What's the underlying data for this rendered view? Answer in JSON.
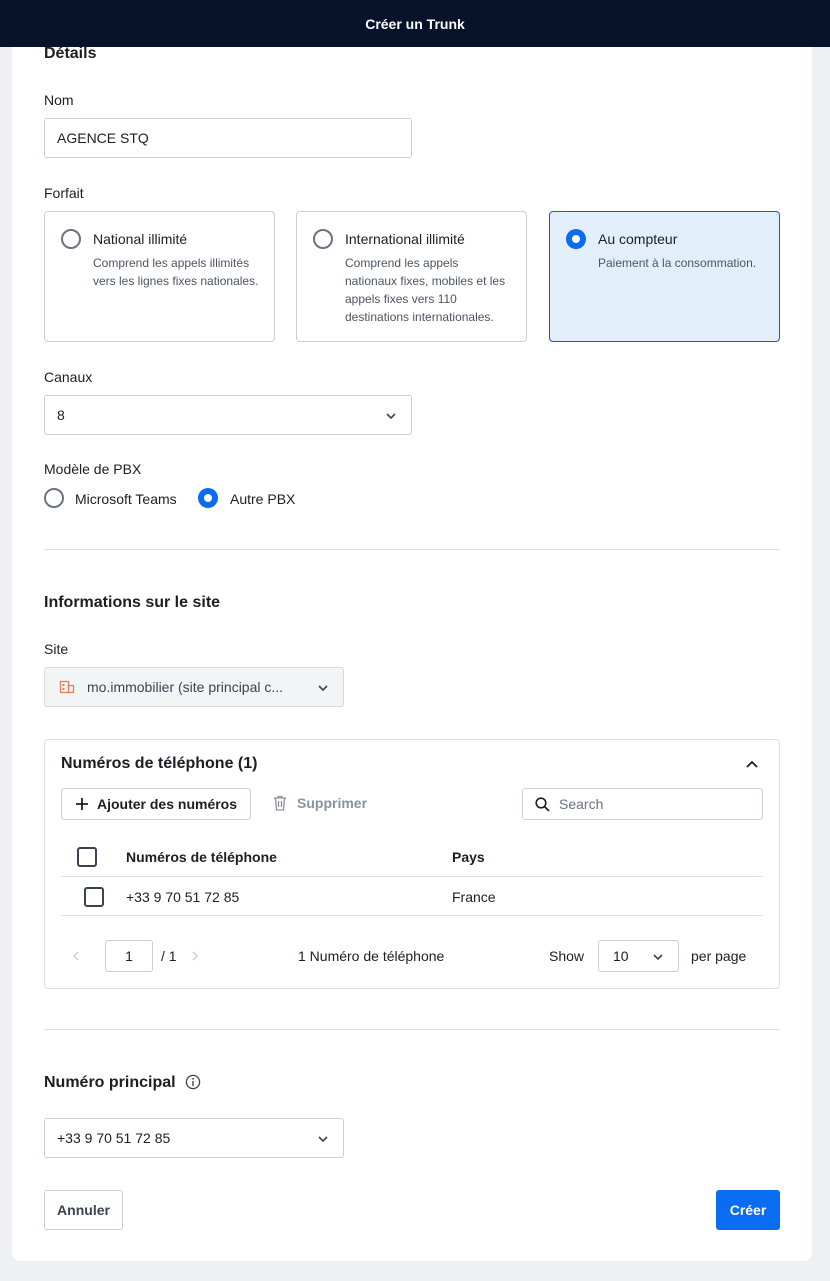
{
  "header": {
    "title": "Créer un Trunk"
  },
  "details": {
    "section_title": "Détails",
    "name_label": "Nom",
    "name_value": "AGENCE STQ",
    "plan_label": "Forfait",
    "plans": [
      {
        "title": "National illimité",
        "desc": "Comprend les appels illimités vers les lignes fixes nationales.",
        "selected": false
      },
      {
        "title": "International illimité",
        "desc": "Comprend les appels nationaux fixes, mobiles et les appels fixes vers 110 destinations internationales.",
        "selected": false
      },
      {
        "title": "Au compteur",
        "desc": "Paiement à la consommation.",
        "selected": true
      }
    ],
    "channels_label": "Canaux",
    "channels_value": "8",
    "pbx_label": "Modèle de PBX",
    "pbx_options": [
      {
        "label": "Microsoft Teams",
        "selected": false
      },
      {
        "label": "Autre PBX",
        "selected": true
      }
    ]
  },
  "site": {
    "section_title": "Informations sur le site",
    "site_label": "Site",
    "site_value": "mo.immobilier (site principal c...",
    "site_icon": "building-icon"
  },
  "phones": {
    "title": "Numéros de téléphone (1)",
    "add_label": "Ajouter des numéros",
    "delete_label": "Supprimer",
    "search_placeholder": "Search",
    "columns": [
      "Numéros de téléphone",
      "Pays"
    ],
    "rows": [
      {
        "number": "+33 9 70 51 72 85",
        "country": "France"
      }
    ],
    "pagination": {
      "page": "1",
      "total_pages": "/ 1",
      "count_text": "1 Numéro de téléphone",
      "show_label": "Show",
      "per_page_value": "10",
      "per_page_label": "per page"
    }
  },
  "main_number": {
    "title": "Numéro principal",
    "value": "+33 9 70 51 72 85"
  },
  "footer": {
    "cancel_label": "Annuler",
    "create_label": "Créer"
  },
  "colors": {
    "primary": "#0a6cf0",
    "header_bg": "#06132b",
    "selected_bg": "#e3eefb"
  }
}
